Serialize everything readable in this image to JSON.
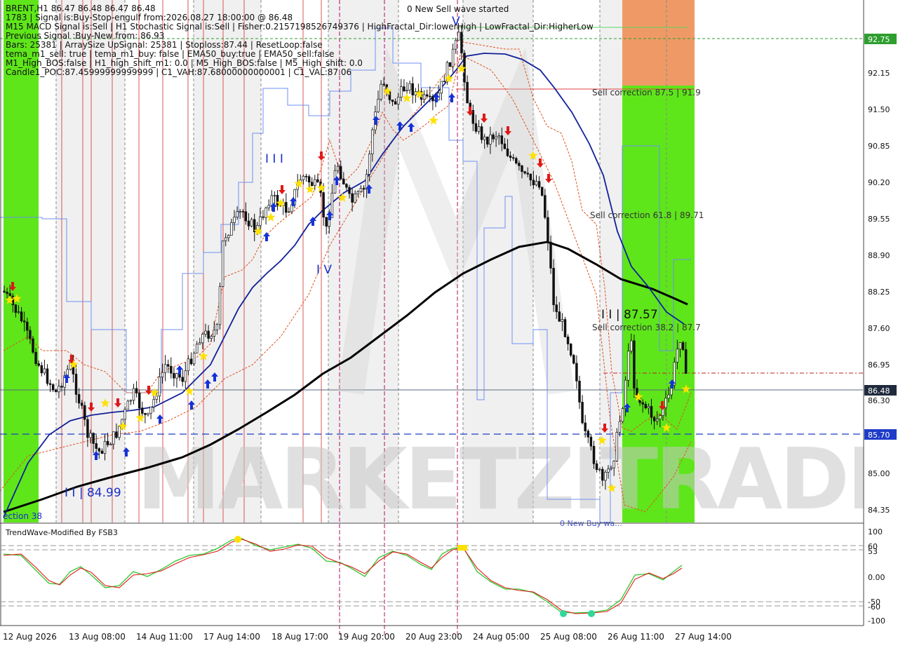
{
  "header": {
    "title": "BRENT,H1  86.47 86.48 86.47 86.48",
    "lines": [
      "1783 | Signal is:Buy-Stop-engulf from:2026.08.27 18:00:00 @ 86.48",
      "M15 MACD Signal is:Sell | H1 Stochastic Signal is:Sell | Fisher:0.2157198526749376 | HighFractal_Dir:lowerHigh | LowFractal_Dir:HigherLow",
      "Previous Signal :Buy-New from: 86.93",
      "Bars: 25381 | ArraySize UpSignal: 25381 | Stoploss:87.44 | ResetLoop:false",
      "tema_m1_sell: true | tema_m1_buy: false | EMA50_buy:true | EMA50_sell:false",
      "M1_High_BOS:false | H1_high_shift_m1: 0.0 | M5_High_BOS:false | M5_High_shift: 0.0",
      "Candle1_POC:87.45999999999999 | C1_VAH:87.68000000000001 | C1_VAL:87.06"
    ]
  },
  "watermark": "MARKETZITRADE",
  "annotations": {
    "top_center": "0 New Sell wave started",
    "wave_v": "V",
    "wave_iii": "I I I",
    "wave_iv": "I V",
    "wave_ii": "I I | 84.99",
    "wave_iii_low": "I I | 87.57",
    "sell_corr_875": "Sell correction 87.5 | 91.9",
    "sell_corr_618": "Sell correction 61.8 | 89.71",
    "sell_corr_382": "Sell correction 38.2 | 87.7",
    "corr_left": "ection 38",
    "bottom_partial": "0 New Buy wa..."
  },
  "price_axis": {
    "ticks": [
      "92.15",
      "91.50",
      "90.85",
      "90.20",
      "89.55",
      "88.90",
      "88.25",
      "87.60",
      "86.95",
      "86.30",
      "85.00",
      "84.35"
    ],
    "labels": [
      {
        "text": "92.75",
        "bg": "#2e9e2e"
      },
      {
        "text": "86.48",
        "bg": "#1f2b3d"
      },
      {
        "text": "85.70",
        "bg": "#1e3cc8"
      }
    ]
  },
  "time_axis": [
    "12 Aug 2026",
    "13 Aug 08:00",
    "14 Aug 11:00",
    "17 Aug 14:00",
    "18 Aug 17:00",
    "19 Aug 20:00",
    "20 Aug 23:00",
    "24 Aug 05:00",
    "25 Aug 08:00",
    "26 Aug 11:00",
    "27 Aug 14:00"
  ],
  "sub_window": {
    "title": "TrendWave-Modified By FSB3",
    "ticks": [
      "100",
      "60",
      "53",
      "0.00",
      "-50",
      "-60",
      "-100"
    ]
  },
  "colors": {
    "candle": "#111111",
    "blue_arrow": "#1532d8",
    "red_arrow": "#e01818",
    "star": "#ffe100",
    "green_zone": "#5ee61a",
    "orange_zone": "#ef9a66",
    "ema_blue": "#10209a",
    "ema_black": "#000000"
  }
}
